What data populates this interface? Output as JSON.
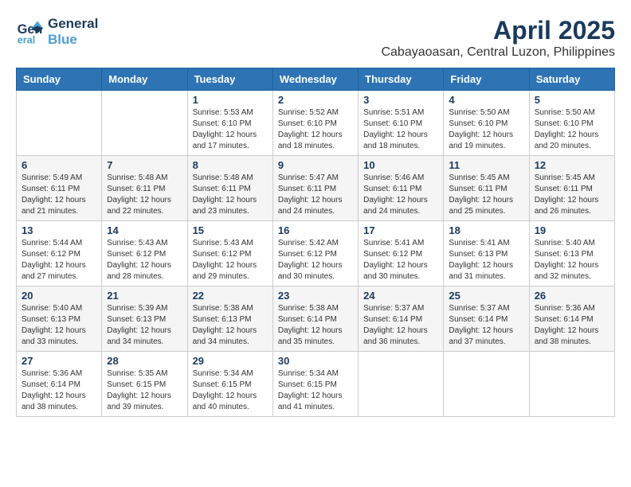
{
  "header": {
    "logo_line1": "General",
    "logo_line2": "Blue",
    "title": "April 2025",
    "subtitle": "Cabayaoasan, Central Luzon, Philippines"
  },
  "weekdays": [
    "Sunday",
    "Monday",
    "Tuesday",
    "Wednesday",
    "Thursday",
    "Friday",
    "Saturday"
  ],
  "weeks": [
    [
      {
        "day": "",
        "info": ""
      },
      {
        "day": "",
        "info": ""
      },
      {
        "day": "1",
        "info": "Sunrise: 5:53 AM\nSunset: 6:10 PM\nDaylight: 12 hours and 17 minutes."
      },
      {
        "day": "2",
        "info": "Sunrise: 5:52 AM\nSunset: 6:10 PM\nDaylight: 12 hours and 18 minutes."
      },
      {
        "day": "3",
        "info": "Sunrise: 5:51 AM\nSunset: 6:10 PM\nDaylight: 12 hours and 18 minutes."
      },
      {
        "day": "4",
        "info": "Sunrise: 5:50 AM\nSunset: 6:10 PM\nDaylight: 12 hours and 19 minutes."
      },
      {
        "day": "5",
        "info": "Sunrise: 5:50 AM\nSunset: 6:10 PM\nDaylight: 12 hours and 20 minutes."
      }
    ],
    [
      {
        "day": "6",
        "info": "Sunrise: 5:49 AM\nSunset: 6:11 PM\nDaylight: 12 hours and 21 minutes."
      },
      {
        "day": "7",
        "info": "Sunrise: 5:48 AM\nSunset: 6:11 PM\nDaylight: 12 hours and 22 minutes."
      },
      {
        "day": "8",
        "info": "Sunrise: 5:48 AM\nSunset: 6:11 PM\nDaylight: 12 hours and 23 minutes."
      },
      {
        "day": "9",
        "info": "Sunrise: 5:47 AM\nSunset: 6:11 PM\nDaylight: 12 hours and 24 minutes."
      },
      {
        "day": "10",
        "info": "Sunrise: 5:46 AM\nSunset: 6:11 PM\nDaylight: 12 hours and 24 minutes."
      },
      {
        "day": "11",
        "info": "Sunrise: 5:45 AM\nSunset: 6:11 PM\nDaylight: 12 hours and 25 minutes."
      },
      {
        "day": "12",
        "info": "Sunrise: 5:45 AM\nSunset: 6:11 PM\nDaylight: 12 hours and 26 minutes."
      }
    ],
    [
      {
        "day": "13",
        "info": "Sunrise: 5:44 AM\nSunset: 6:12 PM\nDaylight: 12 hours and 27 minutes."
      },
      {
        "day": "14",
        "info": "Sunrise: 5:43 AM\nSunset: 6:12 PM\nDaylight: 12 hours and 28 minutes."
      },
      {
        "day": "15",
        "info": "Sunrise: 5:43 AM\nSunset: 6:12 PM\nDaylight: 12 hours and 29 minutes."
      },
      {
        "day": "16",
        "info": "Sunrise: 5:42 AM\nSunset: 6:12 PM\nDaylight: 12 hours and 30 minutes."
      },
      {
        "day": "17",
        "info": "Sunrise: 5:41 AM\nSunset: 6:12 PM\nDaylight: 12 hours and 30 minutes."
      },
      {
        "day": "18",
        "info": "Sunrise: 5:41 AM\nSunset: 6:13 PM\nDaylight: 12 hours and 31 minutes."
      },
      {
        "day": "19",
        "info": "Sunrise: 5:40 AM\nSunset: 6:13 PM\nDaylight: 12 hours and 32 minutes."
      }
    ],
    [
      {
        "day": "20",
        "info": "Sunrise: 5:40 AM\nSunset: 6:13 PM\nDaylight: 12 hours and 33 minutes."
      },
      {
        "day": "21",
        "info": "Sunrise: 5:39 AM\nSunset: 6:13 PM\nDaylight: 12 hours and 34 minutes."
      },
      {
        "day": "22",
        "info": "Sunrise: 5:38 AM\nSunset: 6:13 PM\nDaylight: 12 hours and 34 minutes."
      },
      {
        "day": "23",
        "info": "Sunrise: 5:38 AM\nSunset: 6:14 PM\nDaylight: 12 hours and 35 minutes."
      },
      {
        "day": "24",
        "info": "Sunrise: 5:37 AM\nSunset: 6:14 PM\nDaylight: 12 hours and 36 minutes."
      },
      {
        "day": "25",
        "info": "Sunrise: 5:37 AM\nSunset: 6:14 PM\nDaylight: 12 hours and 37 minutes."
      },
      {
        "day": "26",
        "info": "Sunrise: 5:36 AM\nSunset: 6:14 PM\nDaylight: 12 hours and 38 minutes."
      }
    ],
    [
      {
        "day": "27",
        "info": "Sunrise: 5:36 AM\nSunset: 6:14 PM\nDaylight: 12 hours and 38 minutes."
      },
      {
        "day": "28",
        "info": "Sunrise: 5:35 AM\nSunset: 6:15 PM\nDaylight: 12 hours and 39 minutes."
      },
      {
        "day": "29",
        "info": "Sunrise: 5:34 AM\nSunset: 6:15 PM\nDaylight: 12 hours and 40 minutes."
      },
      {
        "day": "30",
        "info": "Sunrise: 5:34 AM\nSunset: 6:15 PM\nDaylight: 12 hours and 41 minutes."
      },
      {
        "day": "",
        "info": ""
      },
      {
        "day": "",
        "info": ""
      },
      {
        "day": "",
        "info": ""
      }
    ]
  ]
}
